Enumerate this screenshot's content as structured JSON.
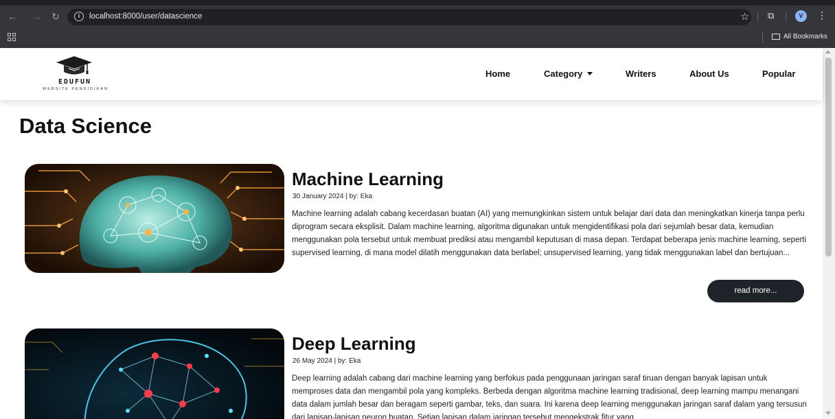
{
  "browser": {
    "url": "localhost:8000/user/datascience",
    "profile_initial": "V",
    "bookmarks_label": "All Bookmarks"
  },
  "site": {
    "logo_name": "EDUFUN",
    "logo_subtitle": "WEBSITE PENDIDIKAN",
    "nav": [
      "Home",
      "Category",
      "Writers",
      "About Us",
      "Popular"
    ]
  },
  "page": {
    "title": "Data Science"
  },
  "articles": [
    {
      "title": "Machine Learning",
      "meta": "30 January 2024 | by: Eka",
      "body": "Machine learning adalah cabang kecerdasan buatan (AI) yang memungkinkan sistem untuk belajar dari data dan meningkatkan kinerja tanpa perlu diprogram secara eksplisit. Dalam machine learning, algoritma digunakan untuk mengidentifikasi pola dari sejumlah besar data, kemudian menggunakan pola tersebut untuk membuat prediksi atau mengambil keputusan di masa depan. Terdapat beberapa jenis machine learning, seperti supervised learning, di mana model dilatih menggunakan data berlabel; unsupervised learning, yang tidak menggunakan label dan bertujuan...",
      "read_more": "read more..."
    },
    {
      "title": "Deep Learning",
      "meta": "26 May 2024 | by: Eka",
      "body": "Deep learning adalah cabang dari machine learning yang berfokus pada penggunaan jaringan saraf tiruan dengan banyak lapisan untuk memproses data dan mengambil pola yang kompleks. Berbeda dengan algoritma machine learning tradisional, deep learning mampu menangani data dalam jumlah besar dan beragam seperti gambar, teks, dan suara. Ini karena deep learning menggunakan jaringan saraf dalam yang tersusun dari lapisan-lapisan neuron buatan. Setiap lapisan dalam jaringan tersebut mengekstrak fitur yang"
    }
  ]
}
